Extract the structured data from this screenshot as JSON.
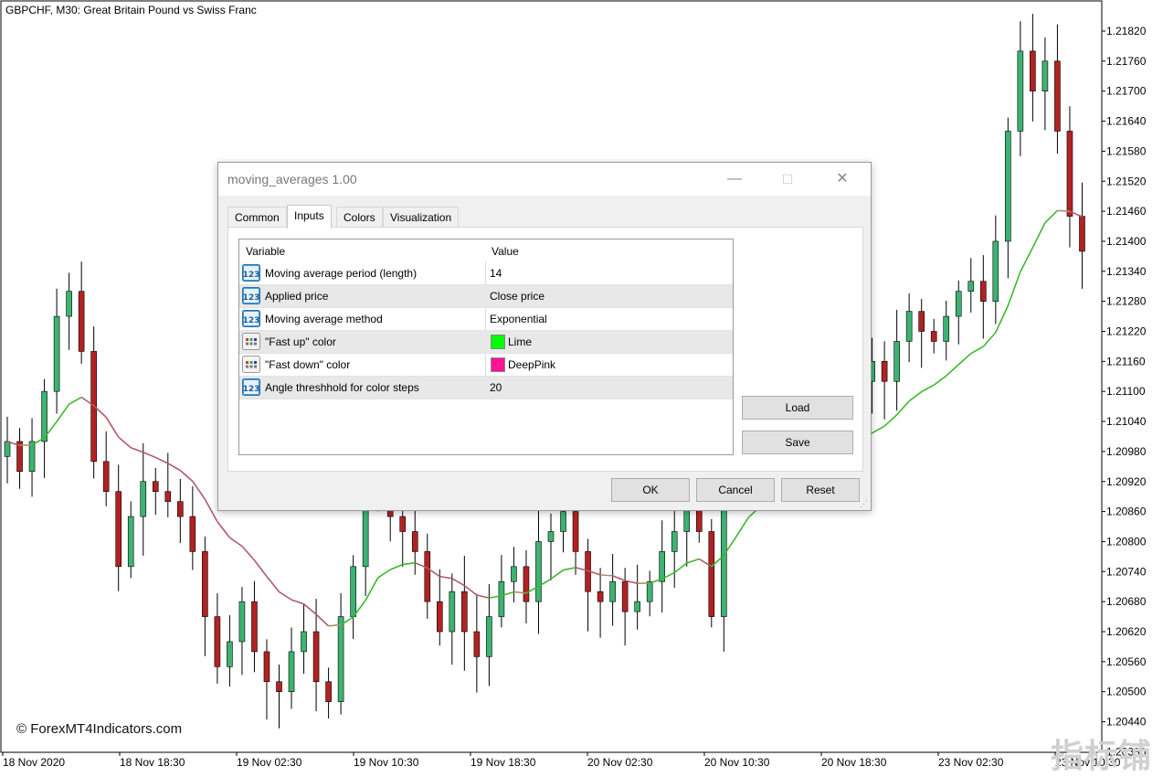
{
  "chart": {
    "title": "GBPCHF, M30:  Great Britain Pound vs Swiss Franc",
    "price_labels": [
      "1.21820",
      "1.21760",
      "1.21700",
      "1.21640",
      "1.21580",
      "1.21520",
      "1.21460",
      "1.21400",
      "1.21340",
      "1.21280",
      "1.21220",
      "1.21160",
      "1.21100",
      "1.21040",
      "1.20980",
      "1.20920",
      "1.20860",
      "1.20800",
      "1.20740",
      "1.20680",
      "1.20620",
      "1.20560",
      "1.20500",
      "1.20440",
      "1.20380"
    ],
    "current_price_y": 1.21378,
    "time_labels": [
      "18 Nov 2020",
      "18 Nov 18:30",
      "19 Nov 02:30",
      "19 Nov 10:30",
      "19 Nov 18:30",
      "20 Nov 02:30",
      "20 Nov 10:30",
      "20 Nov 18:30",
      "23 Nov 02:30",
      "23 Nov 10:30"
    ],
    "watermark": "© ForexMT4Indicators.com",
    "corner_logo": "指标铺",
    "colors": {
      "bull": "#3cb371",
      "bear": "#b22222",
      "ma_up": "#3cb82e",
      "ma_down": "#b05a6a",
      "ma_flat": "#a89070"
    }
  },
  "chart_data": {
    "type": "candlestick",
    "title": "GBPCHF, M30:  Great Britain Pound vs Swiss Franc",
    "ylim": [
      1.2038,
      1.2185
    ],
    "closes_approx": [
      1.21,
      1.2094,
      1.21,
      1.211,
      1.2125,
      1.213,
      1.2118,
      1.2096,
      1.209,
      1.2075,
      1.2085,
      1.2092,
      1.209,
      1.2088,
      1.2085,
      1.2078,
      1.2065,
      1.2055,
      1.206,
      1.2068,
      1.2058,
      1.2052,
      1.205,
      1.2058,
      1.2062,
      1.2052,
      1.2048,
      1.2065,
      1.2075,
      1.209,
      1.2102,
      1.2085,
      1.2082,
      1.2078,
      1.2068,
      1.2062,
      1.207,
      1.2062,
      1.2057,
      1.2065,
      1.2072,
      1.2075,
      1.2068,
      1.208,
      1.2082,
      1.2086,
      1.2078,
      1.207,
      1.2068,
      1.2072,
      1.2066,
      1.2068,
      1.2072,
      1.2078,
      1.2082,
      1.2088,
      1.2082,
      1.2065,
      1.2092,
      1.2105,
      1.211,
      1.2102,
      1.21,
      1.2098,
      1.2095,
      1.2102,
      1.2104,
      1.211,
      1.2108,
      1.2112,
      1.2116,
      1.2112,
      1.212,
      1.2126,
      1.2122,
      1.212,
      1.2125,
      1.213,
      1.2132,
      1.2128,
      1.214,
      1.2162,
      1.2178,
      1.217,
      1.2176,
      1.2162,
      1.2145,
      1.2138
    ]
  },
  "dialog": {
    "title": "moving_averages 1.00",
    "minimize_glyph": "—",
    "maximize_glyph": "☐",
    "close_glyph": "✕",
    "tabs": [
      "Common",
      "Inputs",
      "Colors",
      "Visualization"
    ],
    "active_tab": "Inputs",
    "table": {
      "headers": [
        "Variable",
        "Value"
      ],
      "rows": [
        {
          "icon": "number-icon",
          "variable": "Moving average period (length)",
          "value": "14"
        },
        {
          "icon": "number-icon",
          "variable": "Applied price",
          "value": "Close price"
        },
        {
          "icon": "number-icon",
          "variable": "Moving average method",
          "value": "Exponential"
        },
        {
          "icon": "color-icon",
          "variable": "\"Fast up\" color",
          "value": "Lime",
          "swatch": "#00ff00"
        },
        {
          "icon": "color-icon",
          "variable": "\"Fast down\" color",
          "value": "DeepPink",
          "swatch": "#ff1493"
        },
        {
          "icon": "number-icon",
          "variable": "Angle threshhold for color steps",
          "value": "20"
        }
      ]
    },
    "side_buttons": {
      "load": "Load",
      "save": "Save"
    },
    "footer_buttons": {
      "ok": "OK",
      "cancel": "Cancel",
      "reset": "Reset"
    }
  }
}
